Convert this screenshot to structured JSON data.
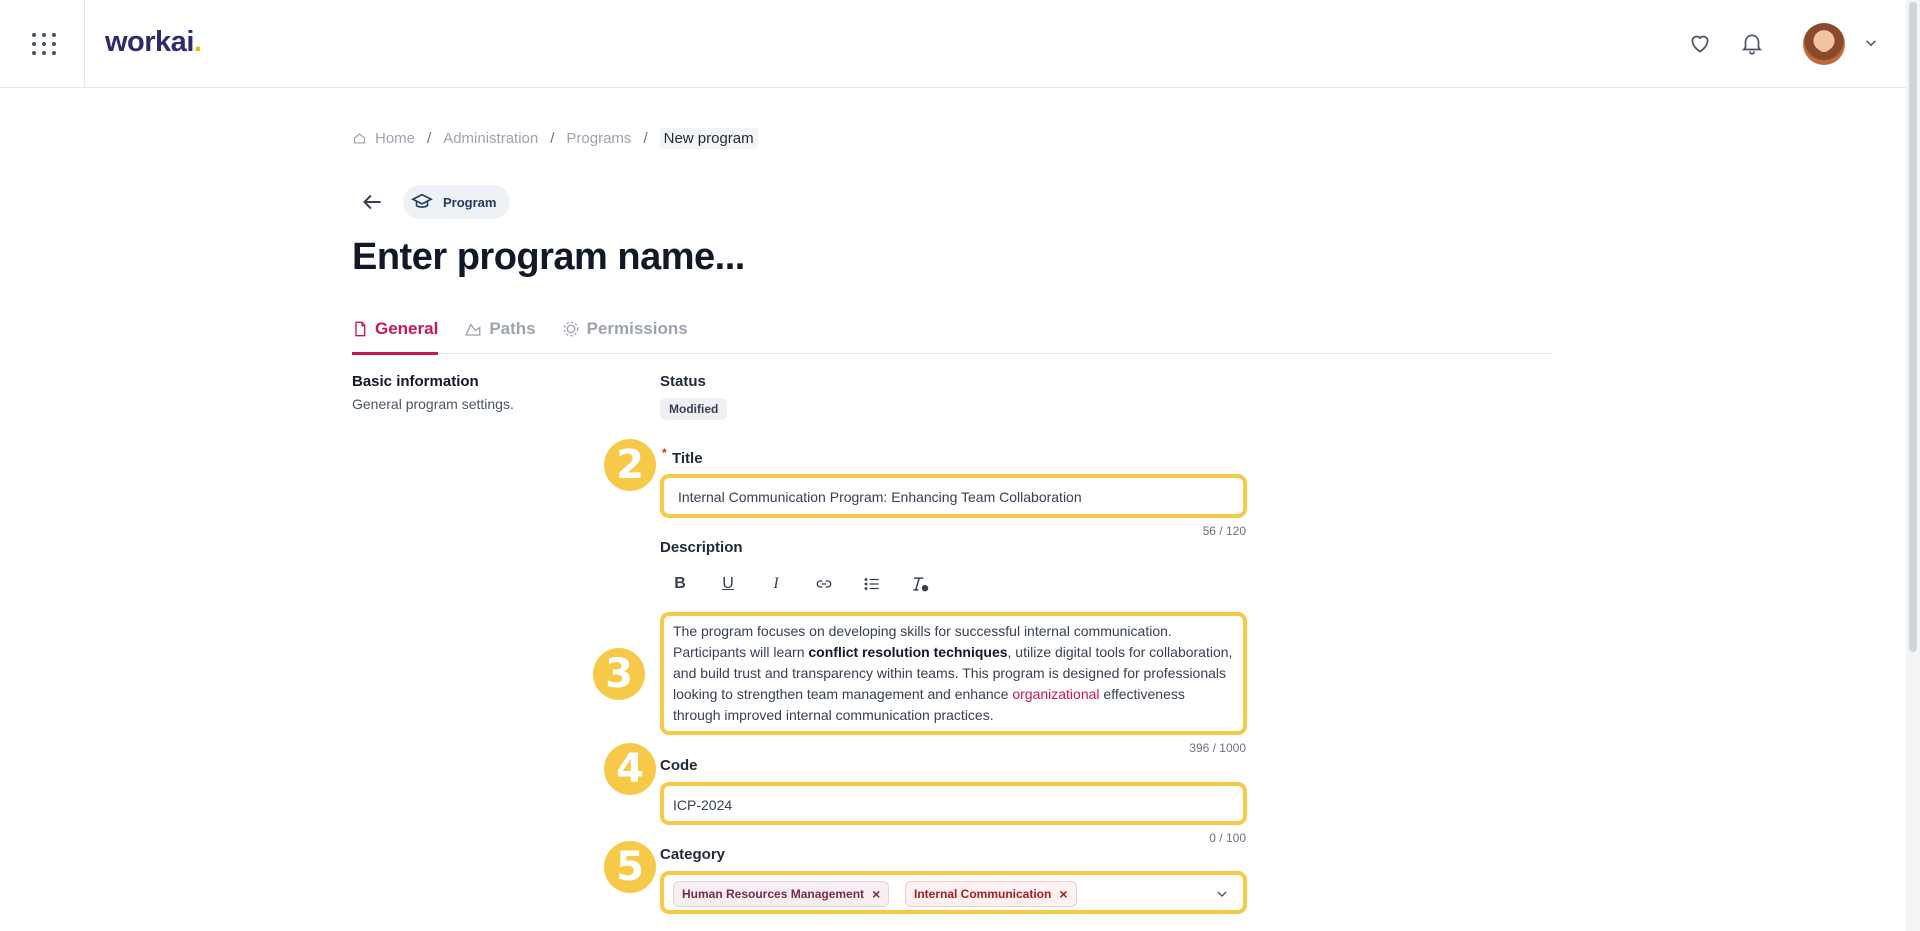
{
  "app": {
    "logo_text": "workai",
    "logo_dot": ".",
    "brand_color": "#2d2a6e",
    "accent_color": "#c8184f",
    "highlight_color": "#f7c948"
  },
  "header": {
    "icons": [
      "apps-grid-icon",
      "heart-icon",
      "bell-icon",
      "avatar",
      "chevron-down-icon"
    ]
  },
  "breadcrumb": {
    "home": "Home",
    "items": [
      "Administration",
      "Programs"
    ],
    "current": "New program",
    "separator": "/"
  },
  "page": {
    "type_label": "Program",
    "title": "Enter program name..."
  },
  "tabs": [
    {
      "label": "General",
      "icon": "file-icon",
      "active": true
    },
    {
      "label": "Paths",
      "icon": "path-icon",
      "active": false
    },
    {
      "label": "Permissions",
      "icon": "users-icon",
      "active": false
    }
  ],
  "section": {
    "title": "Basic information",
    "subtitle": "General program settings."
  },
  "form": {
    "status": {
      "label": "Status",
      "value": "Modified"
    },
    "title": {
      "label": "Title",
      "required": true,
      "value": "Internal Communication Program: Enhancing Team Collaboration",
      "counter": "56 / 120",
      "marker": "2"
    },
    "description": {
      "label": "Description",
      "toolbar": [
        "bold-icon",
        "underline-icon",
        "italic-icon",
        "link-icon",
        "list-icon",
        "clear-format-icon"
      ],
      "part1": "The program focuses on developing skills for successful internal communication. Participants will learn ",
      "bold": "conflict resolution techniques",
      "part2": ", utilize digital tools for collaboration, and build trust and transparency within teams. This program is designed for professionals looking to strengthen team management and enhance ",
      "link": "organizational",
      "part3": " effectiveness through improved internal communication practices.",
      "counter": "396 / 1000",
      "marker": "3"
    },
    "code": {
      "label": "Code",
      "value": "ICP-2024",
      "counter": "0 / 100",
      "marker": "4"
    },
    "category": {
      "label": "Category",
      "tags": [
        "Human Resources Management",
        "Internal Communication"
      ],
      "remove_symbol": "×",
      "marker": "5"
    }
  }
}
